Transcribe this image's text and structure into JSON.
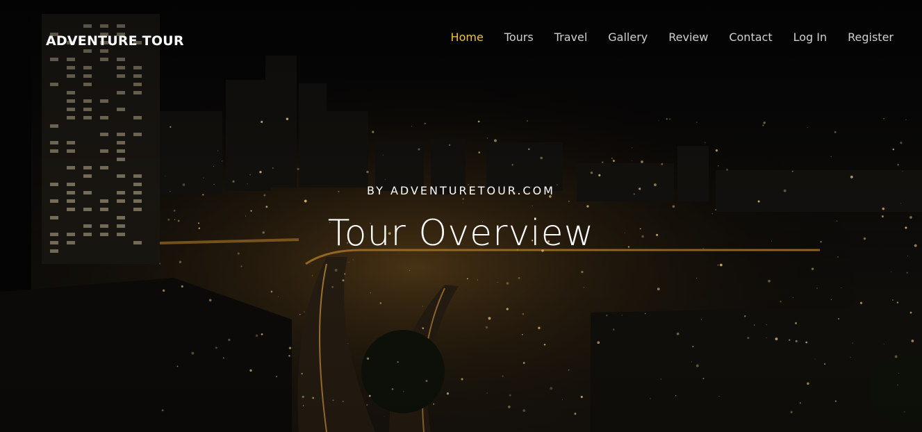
{
  "brand": {
    "name": "ADVENTURE TOUR"
  },
  "nav": {
    "items": [
      {
        "label": "Home"
      },
      {
        "label": "Tours"
      },
      {
        "label": "Travel"
      },
      {
        "label": "Gallery"
      },
      {
        "label": "Review"
      },
      {
        "label": "Contact"
      },
      {
        "label": "Log In"
      },
      {
        "label": "Register"
      }
    ],
    "active_color": "#f2c230",
    "text_color": "#d0d0d0"
  },
  "hero": {
    "subtitle": "BY ADVENTURETOUR.COM",
    "title": "Tour Overview"
  }
}
